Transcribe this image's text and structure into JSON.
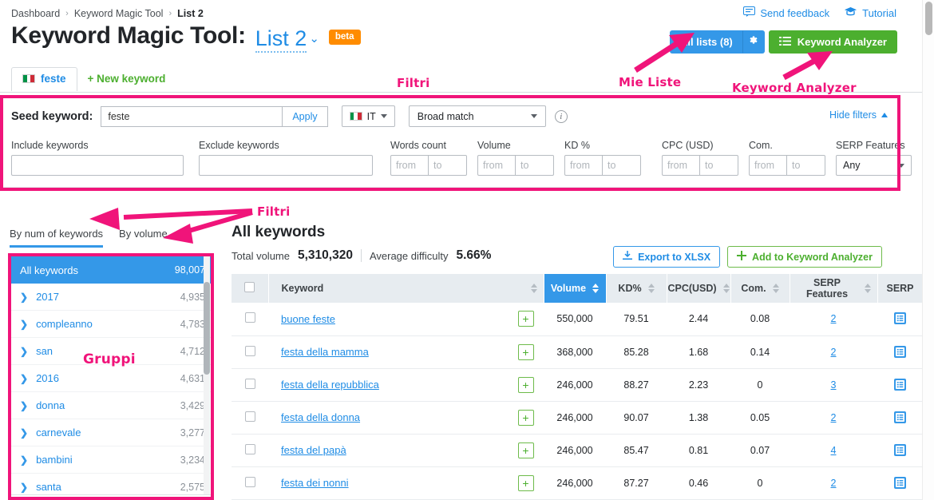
{
  "breadcrumb": {
    "items": [
      "Dashboard",
      "Keyword Magic Tool",
      "List 2"
    ],
    "separator": "›"
  },
  "toplinks": {
    "feedback": "Send feedback",
    "tutorial": "Tutorial"
  },
  "header": {
    "title": "Keyword Magic Tool:",
    "list_name": "List 2",
    "beta": "beta",
    "all_lists": "All lists (8)",
    "keyword_analyzer": "Keyword Analyzer"
  },
  "tabs": {
    "active": "feste",
    "new_keyword": "+ New keyword"
  },
  "filters": {
    "seed_label": "Seed keyword:",
    "seed_value": "feste",
    "apply": "Apply",
    "language": "IT",
    "match_type": "Broad match",
    "hide_filters": "Hide filters",
    "include_label": "Include keywords",
    "include_value": "",
    "exclude_label": "Exclude keywords",
    "exclude_value": "",
    "words_count_label": "Words count",
    "volume_label": "Volume",
    "kd_label": "KD %",
    "cpc_label": "CPC (USD)",
    "com_label": "Com.",
    "serp_features_label": "SERP Features",
    "serp_features_value": "Any",
    "range_from_placeholder": "from",
    "range_to_placeholder": "to",
    "clear_label": "✕"
  },
  "sidebar": {
    "tabs": [
      {
        "label": "By num of keywords",
        "active": true
      },
      {
        "label": "By volume",
        "active": false
      }
    ],
    "all_keywords_label": "All keywords",
    "all_keywords_count": "98,007",
    "groups": [
      {
        "name": "2017",
        "count": "4,935"
      },
      {
        "name": "compleanno",
        "count": "4,783"
      },
      {
        "name": "san",
        "count": "4,712"
      },
      {
        "name": "2016",
        "count": "4,631"
      },
      {
        "name": "donna",
        "count": "3,429"
      },
      {
        "name": "carnevale",
        "count": "3,277"
      },
      {
        "name": "bambini",
        "count": "3,234"
      },
      {
        "name": "santa",
        "count": "2,575"
      }
    ]
  },
  "main": {
    "heading": "All keywords",
    "total_volume_label": "Total volume",
    "total_volume_value": "5,310,320",
    "avg_difficulty_label": "Average difficulty",
    "avg_difficulty_value": "5.66%",
    "export_button": "Export to XLSX",
    "add_button": "Add to Keyword Analyzer",
    "columns": [
      "Keyword",
      "Volume",
      "KD%",
      "CPC(USD)",
      "Com.",
      "SERP Features",
      "SERP"
    ],
    "sorted_column": "Volume",
    "rows": [
      {
        "keyword": "buone feste",
        "volume": "550,000",
        "kd": "79.51",
        "cpc": "2.44",
        "com": "0.08",
        "serp_features": "2"
      },
      {
        "keyword": "festa della mamma",
        "volume": "368,000",
        "kd": "85.28",
        "cpc": "1.68",
        "com": "0.14",
        "serp_features": "2"
      },
      {
        "keyword": "festa della repubblica",
        "volume": "246,000",
        "kd": "88.27",
        "cpc": "2.23",
        "com": "0",
        "serp_features": "3"
      },
      {
        "keyword": "festa della donna",
        "volume": "246,000",
        "kd": "90.07",
        "cpc": "1.38",
        "com": "0.05",
        "serp_features": "2"
      },
      {
        "keyword": "festa del papà",
        "volume": "246,000",
        "kd": "85.47",
        "cpc": "0.81",
        "com": "0.07",
        "serp_features": "4"
      },
      {
        "keyword": "festa dei nonni",
        "volume": "246,000",
        "kd": "87.27",
        "cpc": "0.46",
        "com": "0",
        "serp_features": "2"
      }
    ]
  },
  "annotations": {
    "filtri_top": "Filtri",
    "filtri_side": "Filtri",
    "mie_liste": "Mie Liste",
    "keyword_analyzer": "Keyword Analyzer",
    "gruppi": "Gruppi",
    "color": "#f0147a"
  }
}
